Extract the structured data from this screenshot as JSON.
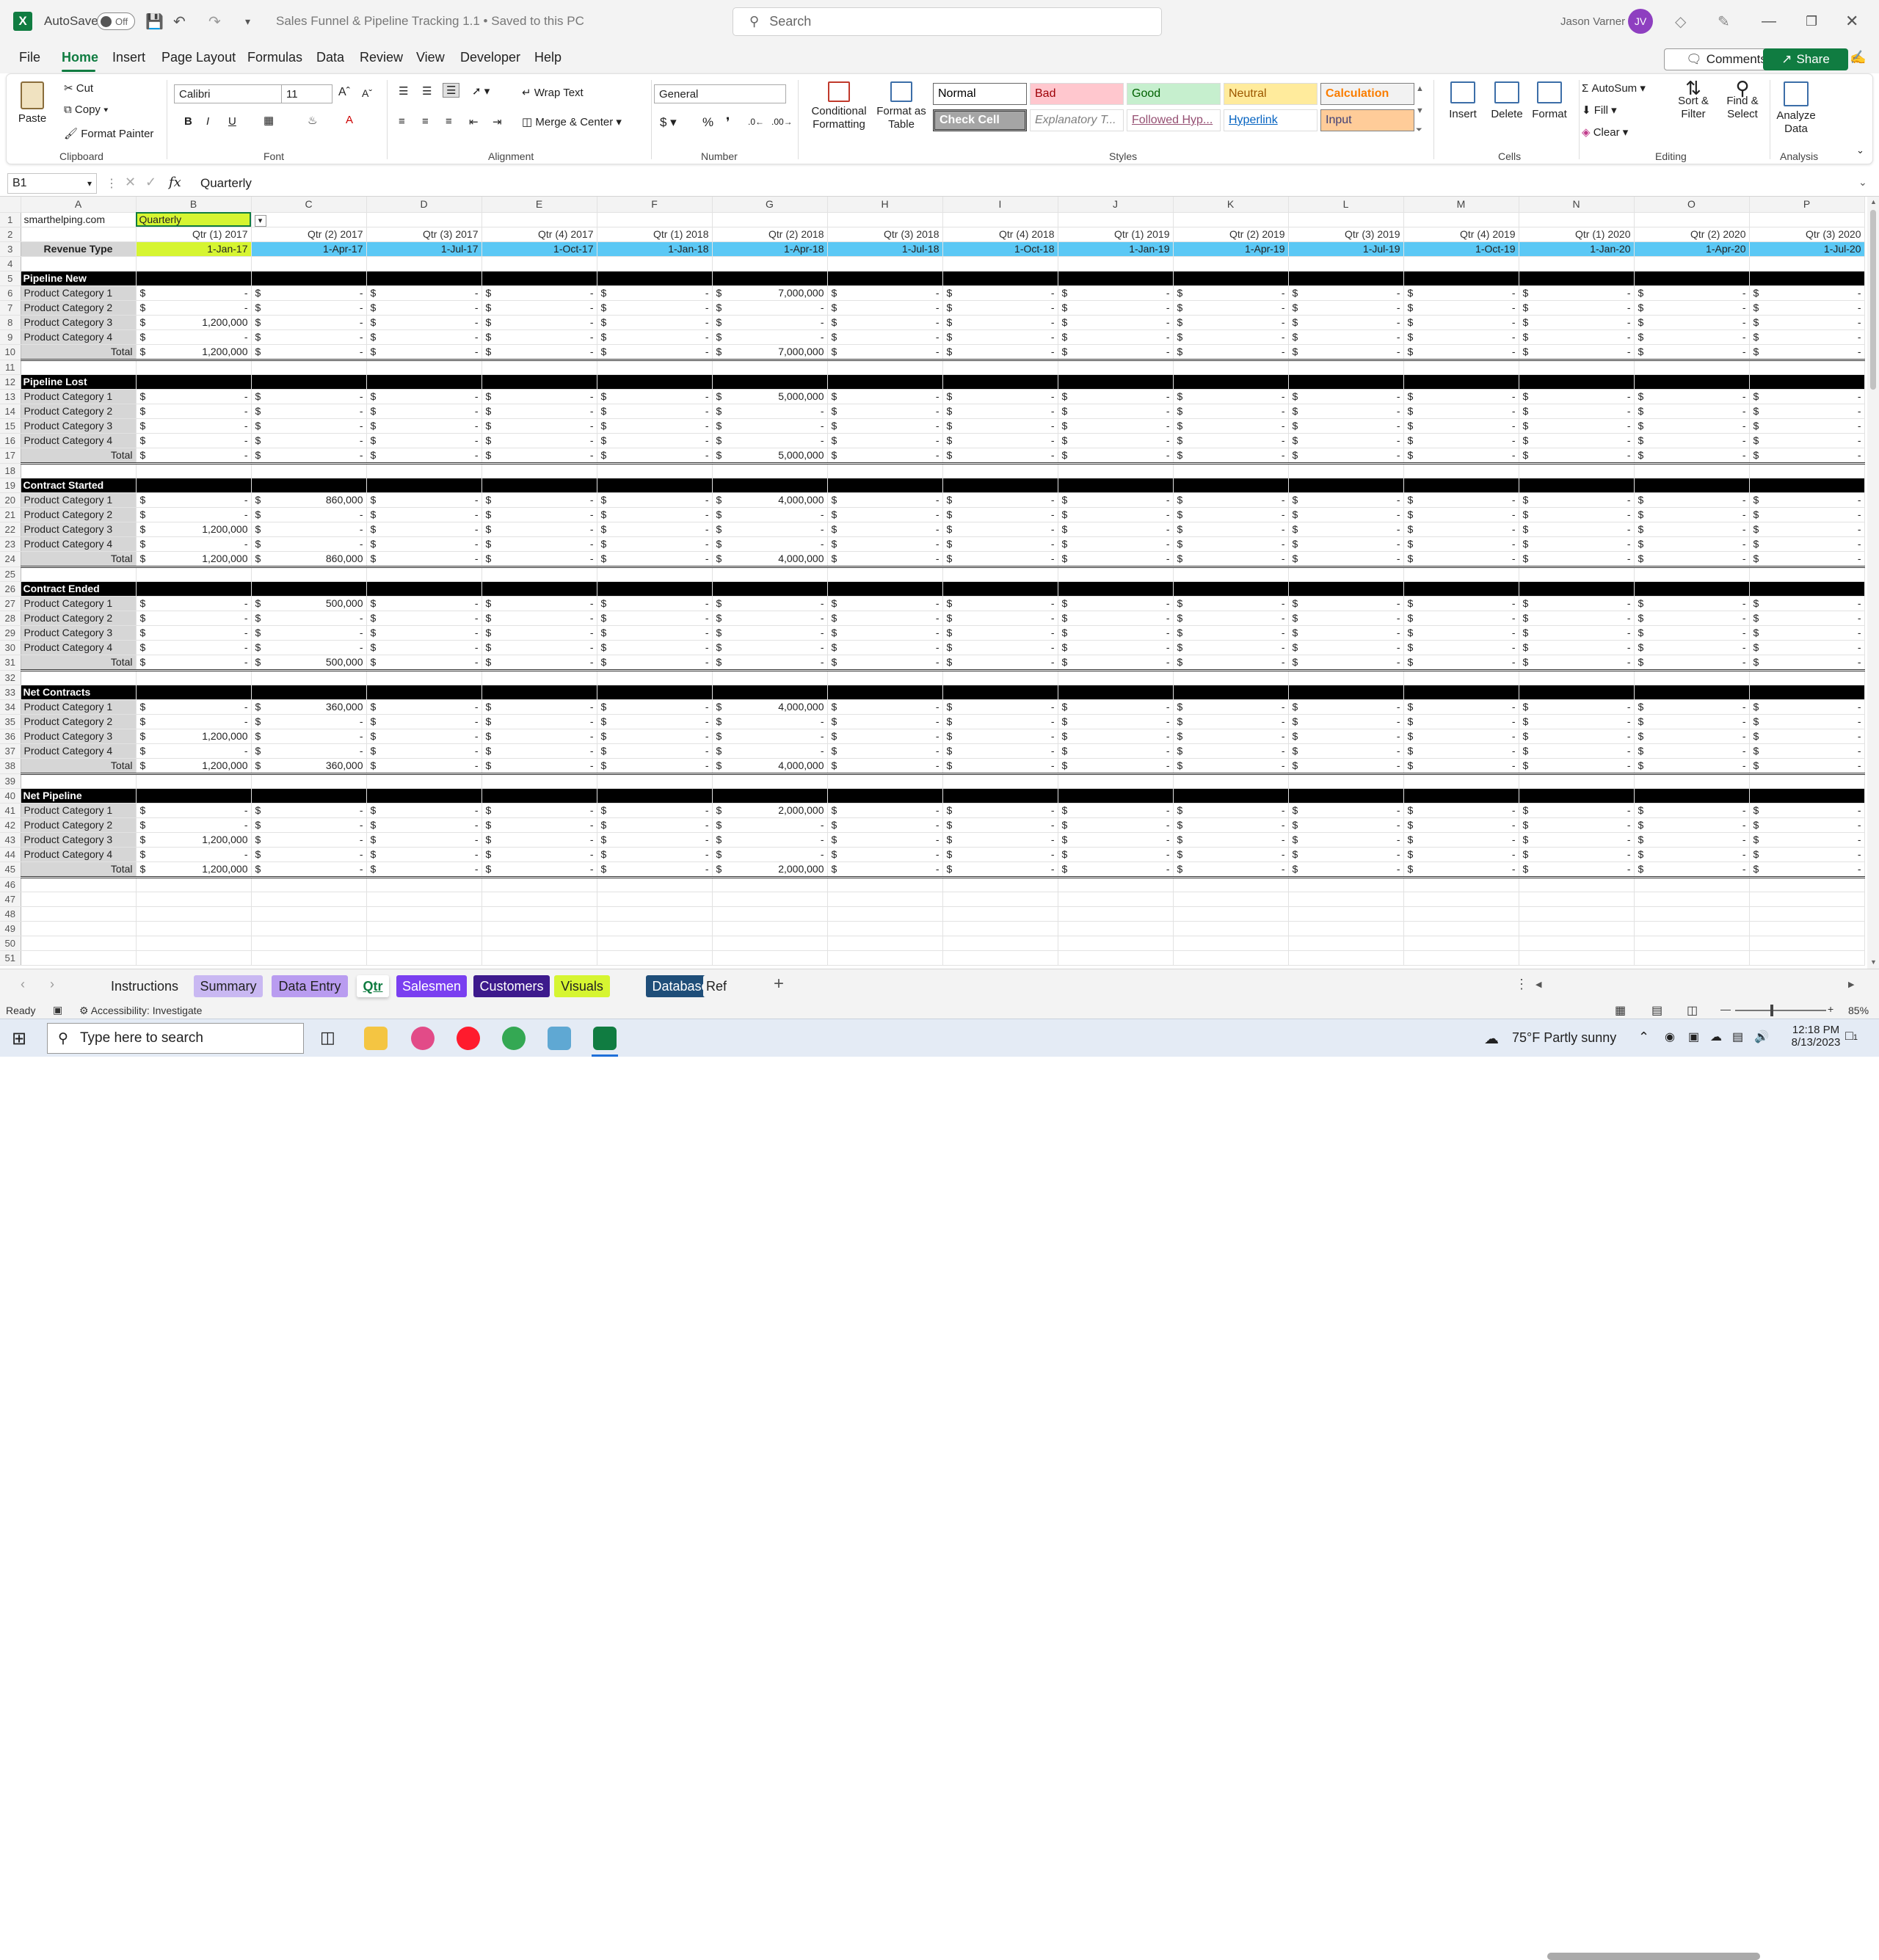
{
  "app": {
    "autosave_label": "AutoSave",
    "autosave_state": "Off",
    "doc_title": "Sales Funnel & Pipeline Tracking 1.1 • Saved to this PC",
    "search_placeholder": "Search",
    "user_name": "Jason Varner",
    "user_initials": "JV"
  },
  "menu": [
    "File",
    "Home",
    "Insert",
    "Page Layout",
    "Formulas",
    "Data",
    "Review",
    "View",
    "Developer",
    "Help"
  ],
  "menu_actions": {
    "comments": "Comments",
    "share": "Share"
  },
  "ribbon": {
    "clipboard": {
      "paste": "Paste",
      "cut": "Cut",
      "copy": "Copy",
      "format_painter": "Format Painter",
      "label": "Clipboard"
    },
    "font": {
      "name": "Calibri",
      "size": "11",
      "label": "Font"
    },
    "alignment": {
      "wrap": "Wrap Text",
      "merge": "Merge & Center",
      "label": "Alignment"
    },
    "number": {
      "format": "General",
      "label": "Number"
    },
    "styles": {
      "cond_fmt": "Conditional Formatting",
      "fmt_table": "Format as Table",
      "label": "Styles",
      "cells": [
        {
          "name": "Normal",
          "bg": "#ffffff",
          "fg": "#000000"
        },
        {
          "name": "Bad",
          "bg": "#ffc7ce",
          "fg": "#9c0006"
        },
        {
          "name": "Good",
          "bg": "#c6efce",
          "fg": "#006100"
        },
        {
          "name": "Neutral",
          "bg": "#ffeb9c",
          "fg": "#9c5700"
        },
        {
          "name": "Calculation",
          "bg": "#f2f2f2",
          "fg": "#fa7d00"
        },
        {
          "name": "Check Cell",
          "bg": "#a5a5a5",
          "fg": "#ffffff"
        },
        {
          "name": "Explanatory T...",
          "bg": "#ffffff",
          "fg": "#7f7f7f"
        },
        {
          "name": "Followed Hyp...",
          "bg": "#ffffff",
          "fg": "#954f72"
        },
        {
          "name": "Hyperlink",
          "bg": "#ffffff",
          "fg": "#0563c1"
        },
        {
          "name": "Input",
          "bg": "#ffcc99",
          "fg": "#3f3f76"
        }
      ]
    },
    "cells": {
      "insert": "Insert",
      "delete": "Delete",
      "format": "Format",
      "label": "Cells"
    },
    "editing": {
      "autosum": "AutoSum",
      "fill": "Fill",
      "clear": "Clear",
      "sort": "Sort & Filter",
      "find": "Find & Select",
      "label": "Editing"
    },
    "analysis": {
      "analyze": "Analyze Data",
      "label": "Analysis"
    }
  },
  "formula_bar": {
    "name_box": "B1",
    "fx": "fx",
    "content": "Quarterly"
  },
  "sheet": {
    "columns": [
      "A",
      "B",
      "C",
      "D",
      "E",
      "F",
      "G",
      "H",
      "I",
      "J",
      "K",
      "L",
      "M",
      "N",
      "O",
      "P"
    ],
    "a1": "smarthelping.com",
    "b1": "Quarterly",
    "revenue_type": "Revenue Type",
    "quarters": [
      "Qtr (1) 2017",
      "Qtr (2) 2017",
      "Qtr (3) 2017",
      "Qtr (4) 2017",
      "Qtr (1) 2018",
      "Qtr (2) 2018",
      "Qtr (3) 2018",
      "Qtr (4) 2018",
      "Qtr (1) 2019",
      "Qtr (2) 2019",
      "Qtr (3) 2019",
      "Qtr (4) 2019",
      "Qtr (1) 2020",
      "Qtr (2) 2020",
      "Qtr (3) 2020"
    ],
    "dates": [
      "1-Jan-17",
      "1-Apr-17",
      "1-Jul-17",
      "1-Oct-17",
      "1-Jan-18",
      "1-Apr-18",
      "1-Jul-18",
      "1-Oct-18",
      "1-Jan-19",
      "1-Apr-19",
      "1-Jul-19",
      "1-Oct-19",
      "1-Jan-20",
      "1-Apr-20",
      "1-Jul-20"
    ],
    "currency": "$",
    "dash": "-",
    "total_label": "Total",
    "sections": [
      {
        "name": "Pipeline New",
        "rows": [
          {
            "label": "Product Category 1",
            "values": {}
          },
          {
            "label": "Product Category 2",
            "values": {}
          },
          {
            "label": "Product Category 3",
            "values": {
              "0": "1,200,000"
            }
          },
          {
            "label": "Product Category 4",
            "values": {}
          }
        ],
        "total": {
          "0": "1,200,000",
          "5": "7,000,000"
        },
        "extra": {
          "0": {
            "5": "7,000,000"
          }
        }
      },
      {
        "name": "Pipeline Lost",
        "rows": [
          {
            "label": "Product Category 1",
            "values": {
              "5": "5,000,000"
            }
          },
          {
            "label": "Product Category 2",
            "values": {}
          },
          {
            "label": "Product Category 3",
            "values": {}
          },
          {
            "label": "Product Category 4",
            "values": {}
          }
        ],
        "total": {
          "5": "5,000,000"
        }
      },
      {
        "name": "Contract Started",
        "rows": [
          {
            "label": "Product Category 1",
            "values": {
              "1": "860,000",
              "5": "4,000,000"
            }
          },
          {
            "label": "Product Category 2",
            "values": {}
          },
          {
            "label": "Product Category 3",
            "values": {
              "0": "1,200,000"
            }
          },
          {
            "label": "Product Category 4",
            "values": {}
          }
        ],
        "total": {
          "0": "1,200,000",
          "1": "860,000",
          "5": "4,000,000"
        }
      },
      {
        "name": "Contract Ended",
        "rows": [
          {
            "label": "Product Category 1",
            "values": {
              "1": "500,000"
            }
          },
          {
            "label": "Product Category 2",
            "values": {}
          },
          {
            "label": "Product Category 3",
            "values": {}
          },
          {
            "label": "Product Category 4",
            "values": {}
          }
        ],
        "total": {
          "1": "500,000"
        }
      },
      {
        "name": "Net Contracts",
        "rows": [
          {
            "label": "Product Category 1",
            "values": {
              "1": "360,000",
              "5": "4,000,000"
            }
          },
          {
            "label": "Product Category 2",
            "values": {}
          },
          {
            "label": "Product Category 3",
            "values": {
              "0": "1,200,000"
            }
          },
          {
            "label": "Product Category 4",
            "values": {}
          }
        ],
        "total": {
          "0": "1,200,000",
          "1": "360,000",
          "5": "4,000,000"
        }
      },
      {
        "name": "Net Pipeline",
        "rows": [
          {
            "label": "Product Category 1",
            "values": {
              "5": "2,000,000"
            }
          },
          {
            "label": "Product Category 2",
            "values": {}
          },
          {
            "label": "Product Category 3",
            "values": {
              "0": "1,200,000"
            }
          },
          {
            "label": "Product Category 4",
            "values": {}
          }
        ],
        "total": {
          "0": "1,200,000",
          "5": "2,000,000"
        }
      }
    ]
  },
  "tabs": [
    {
      "name": "Instructions",
      "bg": "#f3f3f3",
      "fg": "#222222"
    },
    {
      "name": "Summary",
      "bg": "#c9b8f2",
      "fg": "#222222"
    },
    {
      "name": "Data Entry",
      "bg": "#b99cf0",
      "fg": "#222222"
    },
    {
      "name": "Qtr",
      "bg": "#ffffff",
      "fg": "#107c41"
    },
    {
      "name": "Salesmen",
      "bg": "#7a3ff0",
      "fg": "#ffffff"
    },
    {
      "name": "Customers",
      "bg": "#3d1a8c",
      "fg": "#ffffff"
    },
    {
      "name": "Visuals",
      "bg": "#d6f531",
      "fg": "#222222"
    },
    {
      "name": "Database",
      "bg": "#1f4e79",
      "fg": "#ffffff"
    },
    {
      "name": "Ref",
      "bg": "#f3f3f3",
      "fg": "#222222"
    }
  ],
  "status": {
    "ready": "Ready",
    "accessibility": "Accessibility: Investigate",
    "zoom": "85%"
  },
  "taskbar": {
    "search_placeholder": "Type here to search",
    "weather": "75°F  Partly sunny",
    "time": "12:18 PM",
    "date": "8/13/2023",
    "notifications": "1"
  }
}
